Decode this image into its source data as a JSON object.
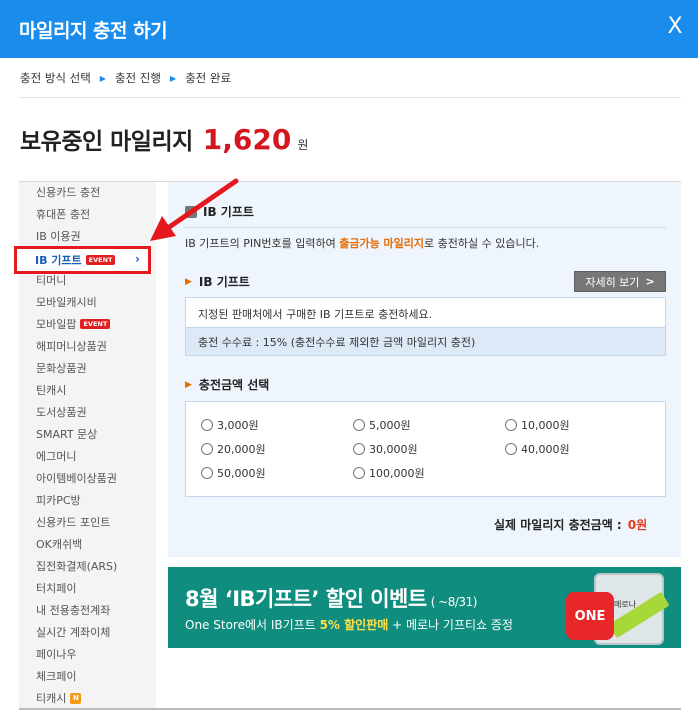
{
  "header": {
    "title": "마일리지 충전 하기",
    "close_glyph": "X"
  },
  "breadcrumb": {
    "steps": [
      "충전 방식 선택",
      "충전 진행",
      "충전 완료"
    ]
  },
  "balance": {
    "label": "보유중인 마일리지",
    "amount": "1,620",
    "unit": "원"
  },
  "sidebar": {
    "items": [
      {
        "label": "신용카드 충전"
      },
      {
        "label": "휴대폰 충전"
      },
      {
        "label": "IB 이용권"
      },
      {
        "label": "IB 기프트",
        "badge": "EVENT",
        "active": true
      },
      {
        "label": "티머니"
      },
      {
        "label": "모바일캐시비"
      },
      {
        "label": "모바일팝",
        "badge": "EVENT"
      },
      {
        "label": "해피머니상품권"
      },
      {
        "label": "문화상품권"
      },
      {
        "label": "틴캐시"
      },
      {
        "label": "도서상품권"
      },
      {
        "label": "SMART 문상"
      },
      {
        "label": "에그머니"
      },
      {
        "label": "아이템베이상품권"
      },
      {
        "label": "피카PC방"
      },
      {
        "label": "신용카드 포인트"
      },
      {
        "label": "OK캐쉬백"
      },
      {
        "label": "집전화결제(ARS)"
      },
      {
        "label": "터치페이"
      },
      {
        "label": "내 전용충전계좌"
      },
      {
        "label": "실시간 계좌이체"
      },
      {
        "label": "페이나우"
      },
      {
        "label": "체크페이"
      },
      {
        "label": "티캐시",
        "badge": "N"
      }
    ]
  },
  "main": {
    "section_title": "IB 기프트",
    "desc_prefix": "IB 기프트의 PIN번호를 입력하여 ",
    "desc_highlight": "출금가능 마일리지",
    "desc_suffix": "로 충전하실 수 있습니다.",
    "gift_subtitle": "IB 기프트",
    "detail_button": "자세히 보기",
    "detail_button_glyph": ">",
    "info_line1": "지정된 판매처에서 구매한 IB 기프트로 충전하세요.",
    "info_line2": "충전 수수료 : 15% (충전수수료 제외한 금액 마일리지 충전)",
    "amount_subtitle": "충전금액 선택",
    "amount_options": [
      "3,000원",
      "5,000원",
      "10,000원",
      "20,000원",
      "30,000원",
      "40,000원",
      "50,000원",
      "100,000원"
    ],
    "total_label": "실제 마일리지 충전금액 :",
    "total_value": "0원"
  },
  "banner": {
    "title": "8월 ‘IB기프트’ 할인 이벤트",
    "title_small": "( ~8/31)",
    "sub_prefix": "One Store에서 IB기프트 ",
    "sub_highlight": "5% 할인판매",
    "sub_suffix": " + 메로나 기프티쇼 증정",
    "one_label": "ONE",
    "phone_text": "메로나"
  },
  "colors": {
    "header_bg": "#1a8ceb",
    "accent_red": "#d4161f",
    "highlight_orange": "#e66b00",
    "banner_bg": "#0f8d7e"
  },
  "icons": {
    "close": "close-icon",
    "breadcrumb_separator": "triangle-right-icon",
    "section": "square-bullet-icon",
    "subtitle": "triangle-right-icon",
    "annotation": "red-arrow-icon"
  }
}
